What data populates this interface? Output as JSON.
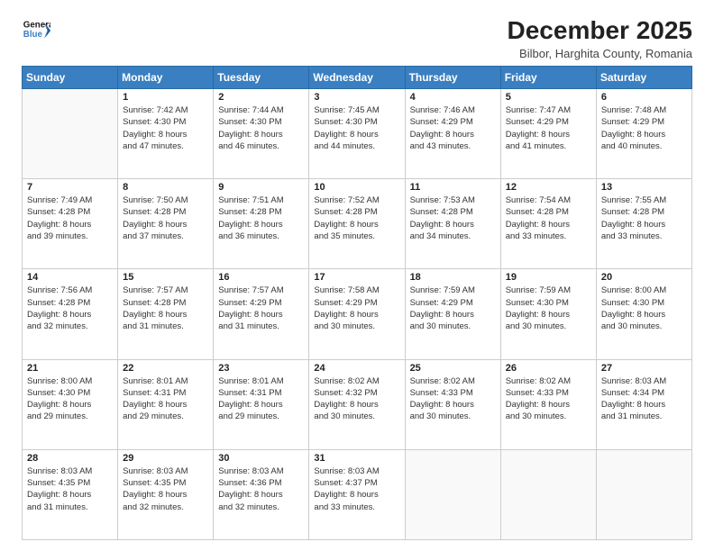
{
  "logo": {
    "line1": "General",
    "line2": "Blue"
  },
  "title": "December 2025",
  "subtitle": "Bilbor, Harghita County, Romania",
  "days_of_week": [
    "Sunday",
    "Monday",
    "Tuesday",
    "Wednesday",
    "Thursday",
    "Friday",
    "Saturday"
  ],
  "weeks": [
    [
      {
        "day": "",
        "info": ""
      },
      {
        "day": "1",
        "info": "Sunrise: 7:42 AM\nSunset: 4:30 PM\nDaylight: 8 hours\nand 47 minutes."
      },
      {
        "day": "2",
        "info": "Sunrise: 7:44 AM\nSunset: 4:30 PM\nDaylight: 8 hours\nand 46 minutes."
      },
      {
        "day": "3",
        "info": "Sunrise: 7:45 AM\nSunset: 4:30 PM\nDaylight: 8 hours\nand 44 minutes."
      },
      {
        "day": "4",
        "info": "Sunrise: 7:46 AM\nSunset: 4:29 PM\nDaylight: 8 hours\nand 43 minutes."
      },
      {
        "day": "5",
        "info": "Sunrise: 7:47 AM\nSunset: 4:29 PM\nDaylight: 8 hours\nand 41 minutes."
      },
      {
        "day": "6",
        "info": "Sunrise: 7:48 AM\nSunset: 4:29 PM\nDaylight: 8 hours\nand 40 minutes."
      }
    ],
    [
      {
        "day": "7",
        "info": "Sunrise: 7:49 AM\nSunset: 4:28 PM\nDaylight: 8 hours\nand 39 minutes."
      },
      {
        "day": "8",
        "info": "Sunrise: 7:50 AM\nSunset: 4:28 PM\nDaylight: 8 hours\nand 37 minutes."
      },
      {
        "day": "9",
        "info": "Sunrise: 7:51 AM\nSunset: 4:28 PM\nDaylight: 8 hours\nand 36 minutes."
      },
      {
        "day": "10",
        "info": "Sunrise: 7:52 AM\nSunset: 4:28 PM\nDaylight: 8 hours\nand 35 minutes."
      },
      {
        "day": "11",
        "info": "Sunrise: 7:53 AM\nSunset: 4:28 PM\nDaylight: 8 hours\nand 34 minutes."
      },
      {
        "day": "12",
        "info": "Sunrise: 7:54 AM\nSunset: 4:28 PM\nDaylight: 8 hours\nand 33 minutes."
      },
      {
        "day": "13",
        "info": "Sunrise: 7:55 AM\nSunset: 4:28 PM\nDaylight: 8 hours\nand 33 minutes."
      }
    ],
    [
      {
        "day": "14",
        "info": "Sunrise: 7:56 AM\nSunset: 4:28 PM\nDaylight: 8 hours\nand 32 minutes."
      },
      {
        "day": "15",
        "info": "Sunrise: 7:57 AM\nSunset: 4:28 PM\nDaylight: 8 hours\nand 31 minutes."
      },
      {
        "day": "16",
        "info": "Sunrise: 7:57 AM\nSunset: 4:29 PM\nDaylight: 8 hours\nand 31 minutes."
      },
      {
        "day": "17",
        "info": "Sunrise: 7:58 AM\nSunset: 4:29 PM\nDaylight: 8 hours\nand 30 minutes."
      },
      {
        "day": "18",
        "info": "Sunrise: 7:59 AM\nSunset: 4:29 PM\nDaylight: 8 hours\nand 30 minutes."
      },
      {
        "day": "19",
        "info": "Sunrise: 7:59 AM\nSunset: 4:30 PM\nDaylight: 8 hours\nand 30 minutes."
      },
      {
        "day": "20",
        "info": "Sunrise: 8:00 AM\nSunset: 4:30 PM\nDaylight: 8 hours\nand 30 minutes."
      }
    ],
    [
      {
        "day": "21",
        "info": "Sunrise: 8:00 AM\nSunset: 4:30 PM\nDaylight: 8 hours\nand 29 minutes."
      },
      {
        "day": "22",
        "info": "Sunrise: 8:01 AM\nSunset: 4:31 PM\nDaylight: 8 hours\nand 29 minutes."
      },
      {
        "day": "23",
        "info": "Sunrise: 8:01 AM\nSunset: 4:31 PM\nDaylight: 8 hours\nand 29 minutes."
      },
      {
        "day": "24",
        "info": "Sunrise: 8:02 AM\nSunset: 4:32 PM\nDaylight: 8 hours\nand 30 minutes."
      },
      {
        "day": "25",
        "info": "Sunrise: 8:02 AM\nSunset: 4:33 PM\nDaylight: 8 hours\nand 30 minutes."
      },
      {
        "day": "26",
        "info": "Sunrise: 8:02 AM\nSunset: 4:33 PM\nDaylight: 8 hours\nand 30 minutes."
      },
      {
        "day": "27",
        "info": "Sunrise: 8:03 AM\nSunset: 4:34 PM\nDaylight: 8 hours\nand 31 minutes."
      }
    ],
    [
      {
        "day": "28",
        "info": "Sunrise: 8:03 AM\nSunset: 4:35 PM\nDaylight: 8 hours\nand 31 minutes."
      },
      {
        "day": "29",
        "info": "Sunrise: 8:03 AM\nSunset: 4:35 PM\nDaylight: 8 hours\nand 32 minutes."
      },
      {
        "day": "30",
        "info": "Sunrise: 8:03 AM\nSunset: 4:36 PM\nDaylight: 8 hours\nand 32 minutes."
      },
      {
        "day": "31",
        "info": "Sunrise: 8:03 AM\nSunset: 4:37 PM\nDaylight: 8 hours\nand 33 minutes."
      },
      {
        "day": "",
        "info": ""
      },
      {
        "day": "",
        "info": ""
      },
      {
        "day": "",
        "info": ""
      }
    ]
  ]
}
